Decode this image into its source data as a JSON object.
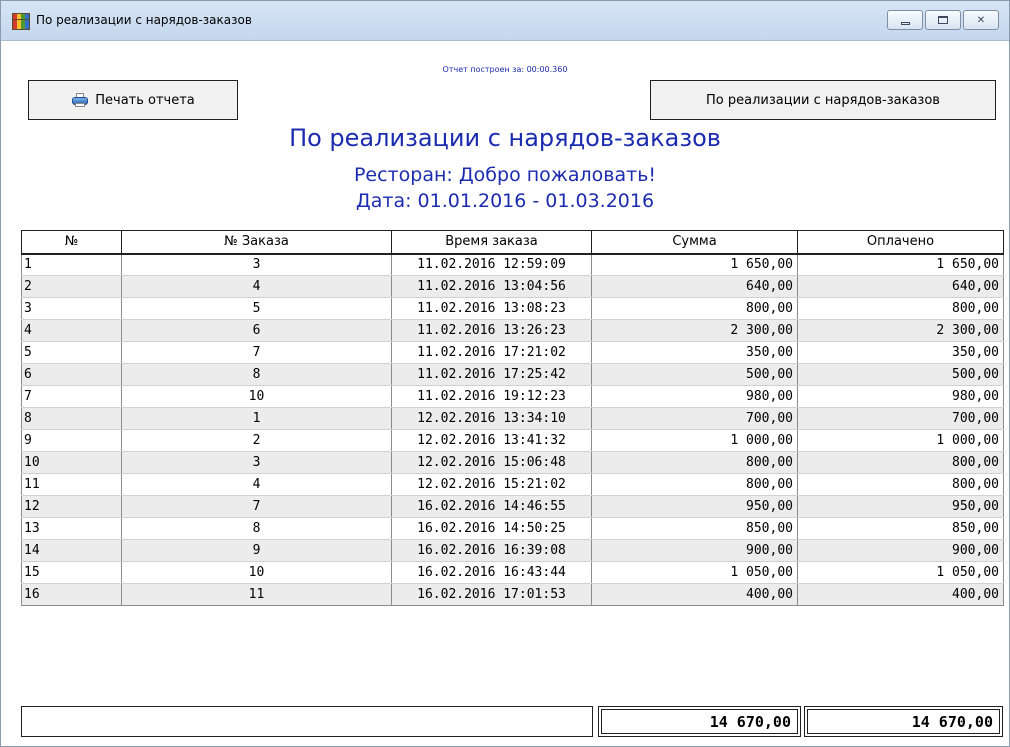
{
  "window": {
    "title": "По реализации с нарядов-заказов",
    "icon": "app-grid-icon",
    "controls": [
      "minimize",
      "maximize",
      "close"
    ]
  },
  "build_time": "Отчет построен за: 00:00.360",
  "buttons": {
    "print_label": "Печать отчета",
    "report_label": "По реализации с нарядов-заказов"
  },
  "report": {
    "title": "По реализации с нарядов-заказов",
    "restaurant": "Ресторан: Добро пожаловать!",
    "date_range": "Дата: 01.01.2016 - 01.03.2016"
  },
  "table": {
    "headers": [
      "№",
      "№ Заказа",
      "Время заказа",
      "Сумма",
      "Оплачено"
    ],
    "rows": [
      [
        "1",
        "3",
        "11.02.2016 12:59:09",
        "1 650,00",
        "1 650,00"
      ],
      [
        "2",
        "4",
        "11.02.2016 13:04:56",
        "640,00",
        "640,00"
      ],
      [
        "3",
        "5",
        "11.02.2016 13:08:23",
        "800,00",
        "800,00"
      ],
      [
        "4",
        "6",
        "11.02.2016 13:26:23",
        "2 300,00",
        "2 300,00"
      ],
      [
        "5",
        "7",
        "11.02.2016 17:21:02",
        "350,00",
        "350,00"
      ],
      [
        "6",
        "8",
        "11.02.2016 17:25:42",
        "500,00",
        "500,00"
      ],
      [
        "7",
        "10",
        "11.02.2016 19:12:23",
        "980,00",
        "980,00"
      ],
      [
        "8",
        "1",
        "12.02.2016 13:34:10",
        "700,00",
        "700,00"
      ],
      [
        "9",
        "2",
        "12.02.2016 13:41:32",
        "1 000,00",
        "1 000,00"
      ],
      [
        "10",
        "3",
        "12.02.2016 15:06:48",
        "800,00",
        "800,00"
      ],
      [
        "11",
        "4",
        "12.02.2016 15:21:02",
        "800,00",
        "800,00"
      ],
      [
        "12",
        "7",
        "16.02.2016 14:46:55",
        "950,00",
        "950,00"
      ],
      [
        "13",
        "8",
        "16.02.2016 14:50:25",
        "850,00",
        "850,00"
      ],
      [
        "14",
        "9",
        "16.02.2016 16:39:08",
        "900,00",
        "900,00"
      ],
      [
        "15",
        "10",
        "16.02.2016 16:43:44",
        "1 050,00",
        "1 050,00"
      ],
      [
        "16",
        "11",
        "16.02.2016 17:01:53",
        "400,00",
        "400,00"
      ]
    ]
  },
  "totals": {
    "sum": "14 670,00",
    "paid": "14 670,00"
  },
  "colors": {
    "accent_text": "#1c2cb0",
    "row_alt": "#ececec"
  }
}
